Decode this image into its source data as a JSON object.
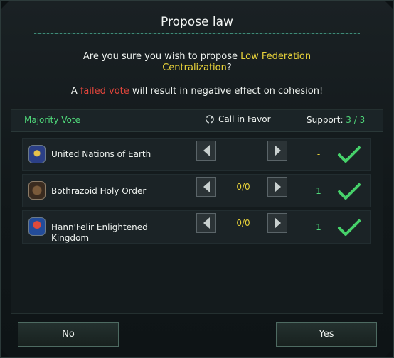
{
  "dialog": {
    "title": "Propose law",
    "question_prefix": "Are you sure you wish to propose ",
    "law_name_line1": "Low Federation",
    "law_name_line2": "Centralization",
    "question_suffix": "?",
    "warning_prefix": "A ",
    "warning_highlight": "failed vote",
    "warning_suffix": " will result in negative effect on cohesion!"
  },
  "table_header": {
    "vote_type": "Majority Vote",
    "call_in_favor": "Call in Favor",
    "support_label": "Support: ",
    "support_value": "3 / 3"
  },
  "members": [
    {
      "name": "United Nations of Earth",
      "emblem": "united-nations-emblem-icon",
      "favor": "-",
      "support": "-"
    },
    {
      "name": "Bothrazoid Holy Order",
      "emblem": "bothrazoid-emblem-icon",
      "favor": "0/0",
      "support": "1"
    },
    {
      "name_line1": "Hann'Felir Enlightened",
      "name_line2": "Kingdom",
      "emblem": "hannfelir-emblem-icon",
      "favor": "0/0",
      "support": "1"
    }
  ],
  "buttons": {
    "no": "No",
    "yes": "Yes"
  },
  "colors": {
    "accent_green": "#4fd87a",
    "accent_yellow": "#e9d33a",
    "accent_red": "#e0453b"
  }
}
